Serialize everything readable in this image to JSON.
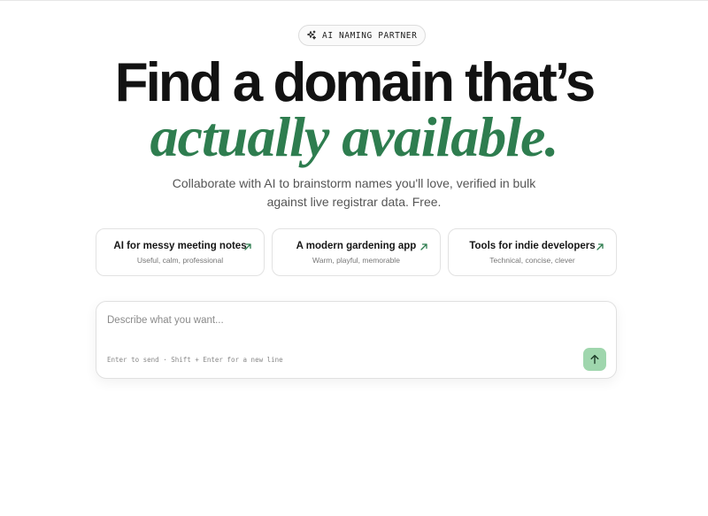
{
  "badge": {
    "label": "AI NAMING PARTNER",
    "icon": "sparkles-icon"
  },
  "hero": {
    "headline": "Find a domain that’s",
    "headline_accent": "actually available.",
    "subtitle": "Collaborate with AI to brainstorm names you'll love, verified in bulk against live registrar data. Free.",
    "accent_color": "#2e7d4f"
  },
  "suggestions": [
    {
      "title": "AI for messy meeting notes",
      "subtitle": "Useful, calm, professional",
      "icon": "arrow-up-right-icon"
    },
    {
      "title": "A modern gardening app",
      "subtitle": "Warm, playful, memorable",
      "icon": "arrow-up-right-icon"
    },
    {
      "title": "Tools for indie developers",
      "subtitle": "Technical, concise, clever",
      "icon": "arrow-up-right-icon"
    }
  ],
  "composer": {
    "value": "",
    "placeholder": "Describe what you want...",
    "hint": "Enter to send · Shift + Enter for a new line",
    "send_icon": "arrow-up-icon",
    "send_color": "#9fd6ad"
  }
}
